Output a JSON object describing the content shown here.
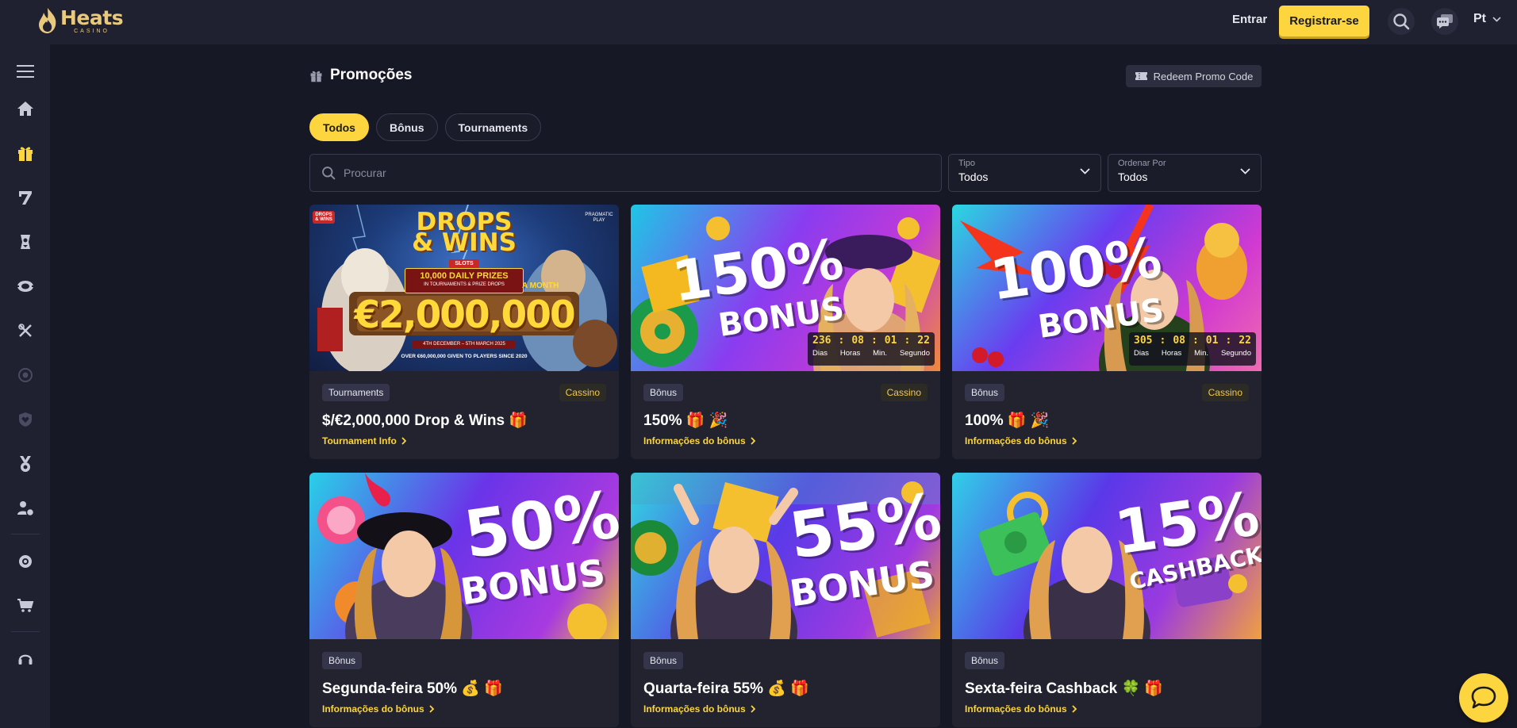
{
  "header": {
    "logo_word": "Heats",
    "logo_sub": "CASINO",
    "login_label": "Entrar",
    "register_label": "Registrar-se",
    "language": "Pt",
    "icons": [
      "search-icon",
      "chat-bubbles-icon",
      "chevron-down-icon"
    ]
  },
  "sidebar": {
    "items": [
      {
        "name": "menu",
        "icon": "hamburger-icon"
      },
      {
        "name": "home",
        "icon": "home-icon"
      },
      {
        "name": "promotions",
        "icon": "gift-icon",
        "active": true
      },
      {
        "name": "slots",
        "icon": "seven-icon"
      },
      {
        "name": "live-casino",
        "icon": "joker-card-icon"
      },
      {
        "name": "table-games",
        "icon": "poker-chip-icon"
      },
      {
        "name": "sports",
        "icon": "crossed-swords-icon"
      },
      {
        "name": "esports",
        "icon": "target-icon"
      },
      {
        "name": "vip",
        "icon": "shield-heart-icon"
      },
      {
        "name": "tournaments",
        "icon": "medal-icon"
      },
      {
        "name": "referral",
        "icon": "user-coin-icon"
      },
      {
        "name": "loyalty",
        "icon": "coin-stack-icon"
      },
      {
        "name": "shop",
        "icon": "cart-icon"
      },
      {
        "name": "support",
        "icon": "headset-icon"
      }
    ]
  },
  "page": {
    "title": "Promoções",
    "promo_code_label": "Redeem Promo Code"
  },
  "tabs": [
    {
      "label": "Todos",
      "active": true
    },
    {
      "label": "Bônus",
      "active": false
    },
    {
      "label": "Tournaments",
      "active": false
    }
  ],
  "search": {
    "placeholder": "Procurar"
  },
  "filters": {
    "type": {
      "label": "Tipo",
      "value": "Todos"
    },
    "sort": {
      "label": "Ordenar Por",
      "value": "Todos"
    }
  },
  "cards": [
    {
      "tag": "Tournaments",
      "category": "Cassino",
      "title": "$/€2,000,000 Drop & Wins 🎁",
      "link": "Tournament Info",
      "banner": {
        "line1": "DROPS",
        "line2": "& WINS",
        "pill": "SLOTS",
        "sub1": "10,000 DAILY PRIZES",
        "sub2": "IN TOURNAMENTS & PRIZE DROPS",
        "month": "A MONTH",
        "amount": "€2,000,000",
        "dates": "4TH DECEMBER – 5TH MARCH 2025",
        "footer": "OVER €60,000,000 GIVEN TO PLAYERS SINCE 2020",
        "brand": "PRAGMATIC PLAY",
        "badge": "DROPS & WINS"
      }
    },
    {
      "tag": "Bônus",
      "category": "Cassino",
      "title": "150% 🎁 🎉",
      "link": "Informações do bônus",
      "banner": {
        "big": "150%",
        "word": "BONUS"
      },
      "timer": {
        "days": "236",
        "hours": "08",
        "minutes": "01",
        "seconds": "22",
        "u_days": "Dias",
        "u_hours": "Horas",
        "u_minutes": "Min.",
        "u_seconds": "Segundo"
      }
    },
    {
      "tag": "Bônus",
      "category": "Cassino",
      "title": "100% 🎁 🎉",
      "link": "Informações do bônus",
      "banner": {
        "big": "100%",
        "word": "BONUS"
      },
      "timer": {
        "days": "305",
        "hours": "08",
        "minutes": "01",
        "seconds": "22",
        "u_days": "Dias",
        "u_hours": "Horas",
        "u_minutes": "Min.",
        "u_seconds": "Segundo"
      }
    },
    {
      "tag": "Bônus",
      "title": "Segunda-feira 50% 💰 🎁",
      "link": "Informações do bônus",
      "banner": {
        "big": "50%",
        "word": "BONUS"
      }
    },
    {
      "tag": "Bônus",
      "title": "Quarta-feira 55% 💰 🎁",
      "link": "Informações do bônus",
      "banner": {
        "big": "55%",
        "word": "BONUS"
      }
    },
    {
      "tag": "Bônus",
      "title": "Sexta-feira Cashback 🍀 🎁",
      "link": "Informações do bônus",
      "banner": {
        "big": "15%",
        "word": "CASHBACK"
      }
    }
  ],
  "colors": {
    "accent": "#fcd53f",
    "background": "#171825",
    "panel": "#1f2030",
    "card": "#22232f"
  }
}
